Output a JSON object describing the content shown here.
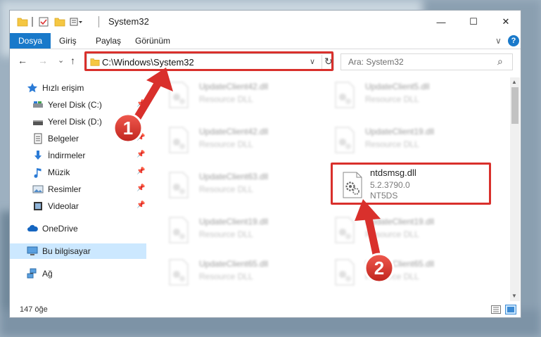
{
  "window": {
    "title": "System32",
    "controls": {
      "minimize": "—",
      "maximize": "☐",
      "close": "✕"
    }
  },
  "ribbon": {
    "tabs": [
      {
        "label": "Dosya",
        "active": true
      },
      {
        "label": "Giriş"
      },
      {
        "label": "Paylaş"
      },
      {
        "label": "Görünüm"
      }
    ],
    "expand": "∨",
    "help": "?"
  },
  "nav": {
    "back": "←",
    "forward": "→",
    "recent": "⌄",
    "up": "↑",
    "address": "C:\\Windows\\System32",
    "address_dropdown": "∨",
    "refresh": "↻",
    "search_placeholder": "Ara: System32",
    "search_icon": "⌕"
  },
  "sidebar": {
    "items": [
      {
        "label": "Hızlı erişim",
        "icon": "star-icon"
      },
      {
        "label": "Yerel Disk (C:)",
        "icon": "drive-icon"
      },
      {
        "label": "Yerel Disk (D:)",
        "icon": "drive-icon"
      },
      {
        "label": "Belgeler",
        "icon": "documents-icon"
      },
      {
        "label": "İndirmeler",
        "icon": "downloads-icon"
      },
      {
        "label": "Müzik",
        "icon": "music-icon"
      },
      {
        "label": "Resimler",
        "icon": "pictures-icon"
      },
      {
        "label": "Videolar",
        "icon": "videos-icon"
      },
      {
        "label": "OneDrive",
        "icon": "cloud-icon"
      },
      {
        "label": "Bu bilgisayar",
        "icon": "computer-icon"
      },
      {
        "label": "Ağ",
        "icon": "network-icon"
      }
    ]
  },
  "files": [
    {
      "name": "UpdateClient42.dll",
      "desc": "Resource DLL"
    },
    {
      "name": "UpdateClient5.dll",
      "desc": "Resource DLL"
    },
    {
      "name": "UpdateClient42.dll",
      "desc": "Resource DLL"
    },
    {
      "name": "UpdateClient19.dll",
      "desc": "Resource DLL"
    },
    {
      "name": "UpdateClient63.dll",
      "desc": "Resource DLL"
    },
    {
      "name": "ntdsmsg.dll",
      "version": "5.2.3790.0",
      "desc": "NT5DS"
    },
    {
      "name": "UpdateClient19.dll",
      "desc": "Resource DLL"
    },
    {
      "name": "UpdateClient19.dll",
      "desc": "Resource DLL"
    },
    {
      "name": "UpdateClient65.dll",
      "desc": "Resource DLL"
    },
    {
      "name": "UpdateClient65.dll",
      "desc": "Resource DLL"
    }
  ],
  "status": {
    "count": "147 öğe"
  },
  "annotations": {
    "step1": "1",
    "step2": "2",
    "color": "#d9302c"
  }
}
